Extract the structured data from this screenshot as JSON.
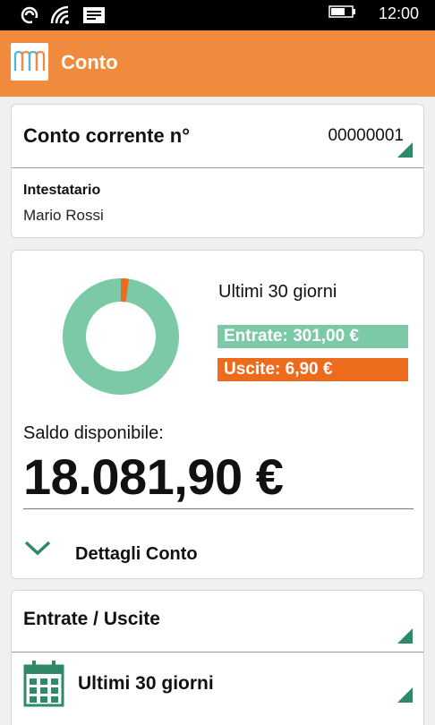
{
  "status_bar": {
    "time": "12:00",
    "icons": [
      "nfc-icon",
      "wifi-icon",
      "message-icon",
      "battery-icon"
    ]
  },
  "header": {
    "title": "Conto",
    "logo_icon": "bank-logo-icon"
  },
  "account": {
    "label": "Conto corrente n°",
    "number": "00000001",
    "holder_label": "Intestatario",
    "holder_name": "Mario Rossi"
  },
  "summary": {
    "period": "Ultimi 30 giorni",
    "income_text": "Entrate:  301,00 €",
    "expense_text": "Uscite:  6,90 €",
    "income_value": 301.0,
    "expense_value": 6.9,
    "balance_label": "Saldo disponibile:",
    "balance_value": "18.081,90 €",
    "details_label": "Dettagli Conto"
  },
  "filters": {
    "flow_label": "Entrate / Uscite",
    "range_label": "Ultimi 30 giorni"
  },
  "colors": {
    "header_orange": "#f08a3d",
    "income_green": "#7cc9a8",
    "expense_orange": "#ec6b1c",
    "accent_dark_green": "#2f8866"
  }
}
